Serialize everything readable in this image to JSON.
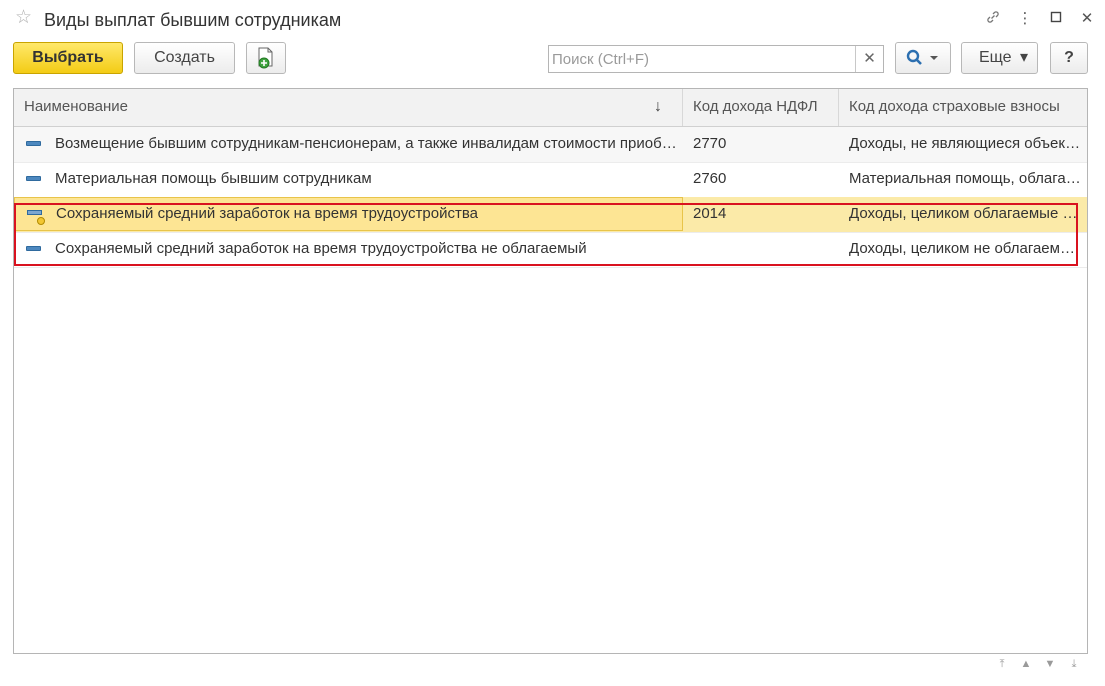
{
  "window": {
    "title": "Виды выплат бывшим сотрудникам",
    "icons": [
      "star-icon",
      "link-icon",
      "more-vertical-icon",
      "maximize-icon",
      "close-icon"
    ]
  },
  "toolbar": {
    "select_label": "Выбрать",
    "create_label": "Создать",
    "search_placeholder": "Поиск (Ctrl+F)",
    "search_value": "",
    "more_label": "Еще",
    "help_label": "?"
  },
  "table": {
    "columns": [
      "Наименование",
      "Код дохода НДФЛ",
      "Код дохода страховые взносы"
    ],
    "rows": [
      {
        "name": "Возмещение бывшим сотрудникам-пенсионерам, а также инвалидам стоимости приобретенных лекарств",
        "ndfl": "2770",
        "insurance": "Доходы, не являющиеся объектом обложения"
      },
      {
        "name": "Материальная помощь бывшим сотрудникам",
        "ndfl": "2760",
        "insurance": "Материальная помощь, облагаемая частично"
      },
      {
        "name": "Сохраняемый средний заработок на время трудоустройства",
        "ndfl": "2014",
        "insurance": "Доходы, целиком облагаемые страховыми взносами"
      },
      {
        "name": "Сохраняемый средний заработок на время трудоустройства не облагаемый",
        "ndfl": "",
        "insurance": "Доходы, целиком не облагаемые страховыми взносами"
      }
    ]
  },
  "colors": {
    "primary_button": "#f3cc15",
    "selected_row": "#fbeaa8",
    "highlight_border": "#d9121f"
  }
}
